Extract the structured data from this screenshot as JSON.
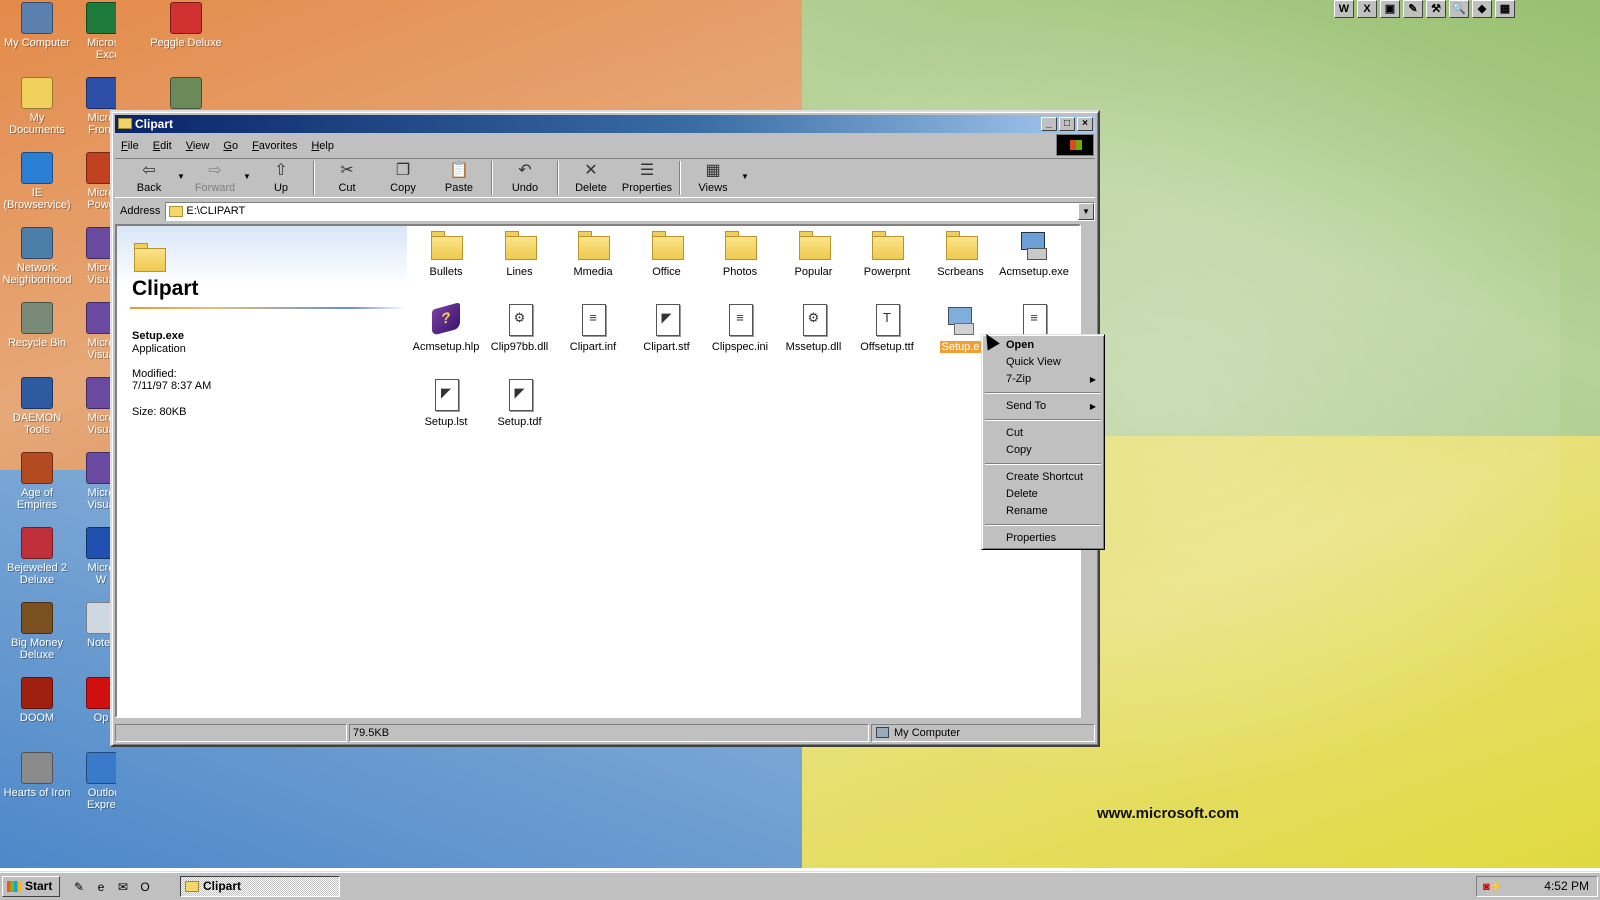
{
  "desktop": {
    "icons_col1": [
      {
        "label": "My Computer",
        "icon": "my-computer-icon"
      },
      {
        "label": "My Documents",
        "icon": "my-documents-icon"
      },
      {
        "label": "IE (Browservice)",
        "icon": "internet-explorer-icon"
      },
      {
        "label": "Network Neighborhood",
        "icon": "network-neighborhood-icon"
      },
      {
        "label": "Recycle Bin",
        "icon": "recycle-bin-icon"
      },
      {
        "label": "DAEMON Tools",
        "icon": "daemon-tools-icon"
      },
      {
        "label": "Age of Empires",
        "icon": "age-of-empires-icon"
      },
      {
        "label": "Bejeweled 2 Deluxe",
        "icon": "bejeweled-icon"
      },
      {
        "label": "Big Money Deluxe",
        "icon": "big-money-icon"
      },
      {
        "label": "DOOM",
        "icon": "doom-icon"
      },
      {
        "label": "Hearts of Iron",
        "icon": "hearts-of-iron-icon"
      }
    ],
    "icons_col2": [
      {
        "label": "Microsoft Excel",
        "icon": "excel-icon"
      },
      {
        "label": "Micro Front",
        "icon": "frontpage-icon"
      },
      {
        "label": "Micro Powe",
        "icon": "powerpoint-icon"
      },
      {
        "label": "Micro Visua",
        "icon": "visual-studio-icon"
      },
      {
        "label": "Micro Visua",
        "icon": "visual-studio-icon"
      },
      {
        "label": "Micro Visua",
        "icon": "visual-studio-icon"
      },
      {
        "label": "Micro Visua",
        "icon": "visual-studio-icon"
      },
      {
        "label": "Micro W",
        "icon": "word-icon"
      },
      {
        "label": "Notep",
        "icon": "notepad-icon"
      },
      {
        "label": "Op",
        "icon": "opera-icon"
      },
      {
        "label": "Outlook Express",
        "icon": "outlook-express-icon"
      }
    ],
    "icons_col3": [
      {
        "label": "Peggle Deluxe",
        "icon": "peggle-icon"
      },
      {
        "label": "",
        "icon": "plant-shortcut-icon"
      }
    ],
    "wallpaper_url": "www.microsoft.com",
    "colors": {
      "orange": "#e48a4a",
      "green": "#98c070",
      "blue": "#4d88c9",
      "yellow": "#e0da40"
    }
  },
  "top_toolbar": {
    "buttons": [
      "W",
      "X",
      "▣",
      "✎",
      "⚒",
      "🔍",
      "◆",
      "▦"
    ]
  },
  "window": {
    "title": "Clipart",
    "title_color": "#0a246a",
    "menu": [
      "File",
      "Edit",
      "View",
      "Go",
      "Favorites",
      "Help"
    ],
    "toolbar": [
      {
        "label": "Back",
        "icon": "back-arrow-icon",
        "enabled": true
      },
      {
        "label": "Forward",
        "icon": "forward-arrow-icon",
        "enabled": false
      },
      {
        "label": "Up",
        "icon": "up-folder-icon",
        "enabled": true
      },
      {
        "label": "Cut",
        "icon": "scissors-icon",
        "enabled": true
      },
      {
        "label": "Copy",
        "icon": "copy-icon",
        "enabled": true
      },
      {
        "label": "Paste",
        "icon": "paste-icon",
        "enabled": true
      },
      {
        "label": "Undo",
        "icon": "undo-icon",
        "enabled": true
      },
      {
        "label": "Delete",
        "icon": "delete-x-icon",
        "enabled": true
      },
      {
        "label": "Properties",
        "icon": "properties-icon",
        "enabled": true
      },
      {
        "label": "Views",
        "icon": "views-icon",
        "enabled": true
      }
    ],
    "address": {
      "label": "Address",
      "value": "E:\\CLIPART"
    },
    "info_pane": {
      "folder_title": "Clipart",
      "selected_name": "Setup.exe",
      "selected_type": "Application",
      "modified_label": "Modified:",
      "modified_value": "7/11/97 8:37 AM",
      "size": "Size: 80KB"
    },
    "files": [
      {
        "name": "Bullets",
        "kind": "folder"
      },
      {
        "name": "Lines",
        "kind": "folder"
      },
      {
        "name": "Mmedia",
        "kind": "folder"
      },
      {
        "name": "Office",
        "kind": "folder"
      },
      {
        "name": "Photos",
        "kind": "folder"
      },
      {
        "name": "Popular",
        "kind": "folder"
      },
      {
        "name": "Powerpnt",
        "kind": "folder"
      },
      {
        "name": "Scrbeans",
        "kind": "folder"
      },
      {
        "name": "Acmsetup.exe",
        "kind": "exe"
      },
      {
        "name": "Acmsetup.hlp",
        "kind": "hlp"
      },
      {
        "name": "Clip97bb.dll",
        "kind": "dll"
      },
      {
        "name": "Clipart.inf",
        "kind": "inf"
      },
      {
        "name": "Clipart.stf",
        "kind": "stf"
      },
      {
        "name": "Clipspec.ini",
        "kind": "ini"
      },
      {
        "name": "Mssetup.dll",
        "kind": "dll"
      },
      {
        "name": "Offsetup.ttf",
        "kind": "ttf"
      },
      {
        "name": "Setup.exe",
        "kind": "exe",
        "selected": true,
        "visible_label": "Setup.e"
      },
      {
        "name": "",
        "kind": "ini"
      },
      {
        "name": "Setup.lst",
        "kind": "stf"
      },
      {
        "name": "Setup.tdf",
        "kind": "stf"
      }
    ],
    "status": {
      "size": "79.5KB",
      "zone": "My Computer"
    }
  },
  "context_menu": {
    "items": [
      {
        "label": "Open",
        "bold": true
      },
      {
        "label": "Quick View"
      },
      {
        "label": "7-Zip",
        "submenu": true
      },
      {
        "sep": true
      },
      {
        "label": "Send To",
        "submenu": true
      },
      {
        "sep": true
      },
      {
        "label": "Cut"
      },
      {
        "label": "Copy"
      },
      {
        "sep": true
      },
      {
        "label": "Create Shortcut"
      },
      {
        "label": "Delete"
      },
      {
        "label": "Rename"
      },
      {
        "sep": true
      },
      {
        "label": "Properties"
      }
    ]
  },
  "taskbar": {
    "start_label": "Start",
    "quick_launch": [
      {
        "glyph": "✎",
        "icon": "show-desktop-icon"
      },
      {
        "glyph": "e",
        "icon": "ie-quicklaunch-icon"
      },
      {
        "glyph": "✉",
        "icon": "outlook-quicklaunch-icon"
      },
      {
        "glyph": "O",
        "icon": "opera-quicklaunch-icon"
      }
    ],
    "active_task": "Clipart",
    "clock": "4:52 PM"
  }
}
